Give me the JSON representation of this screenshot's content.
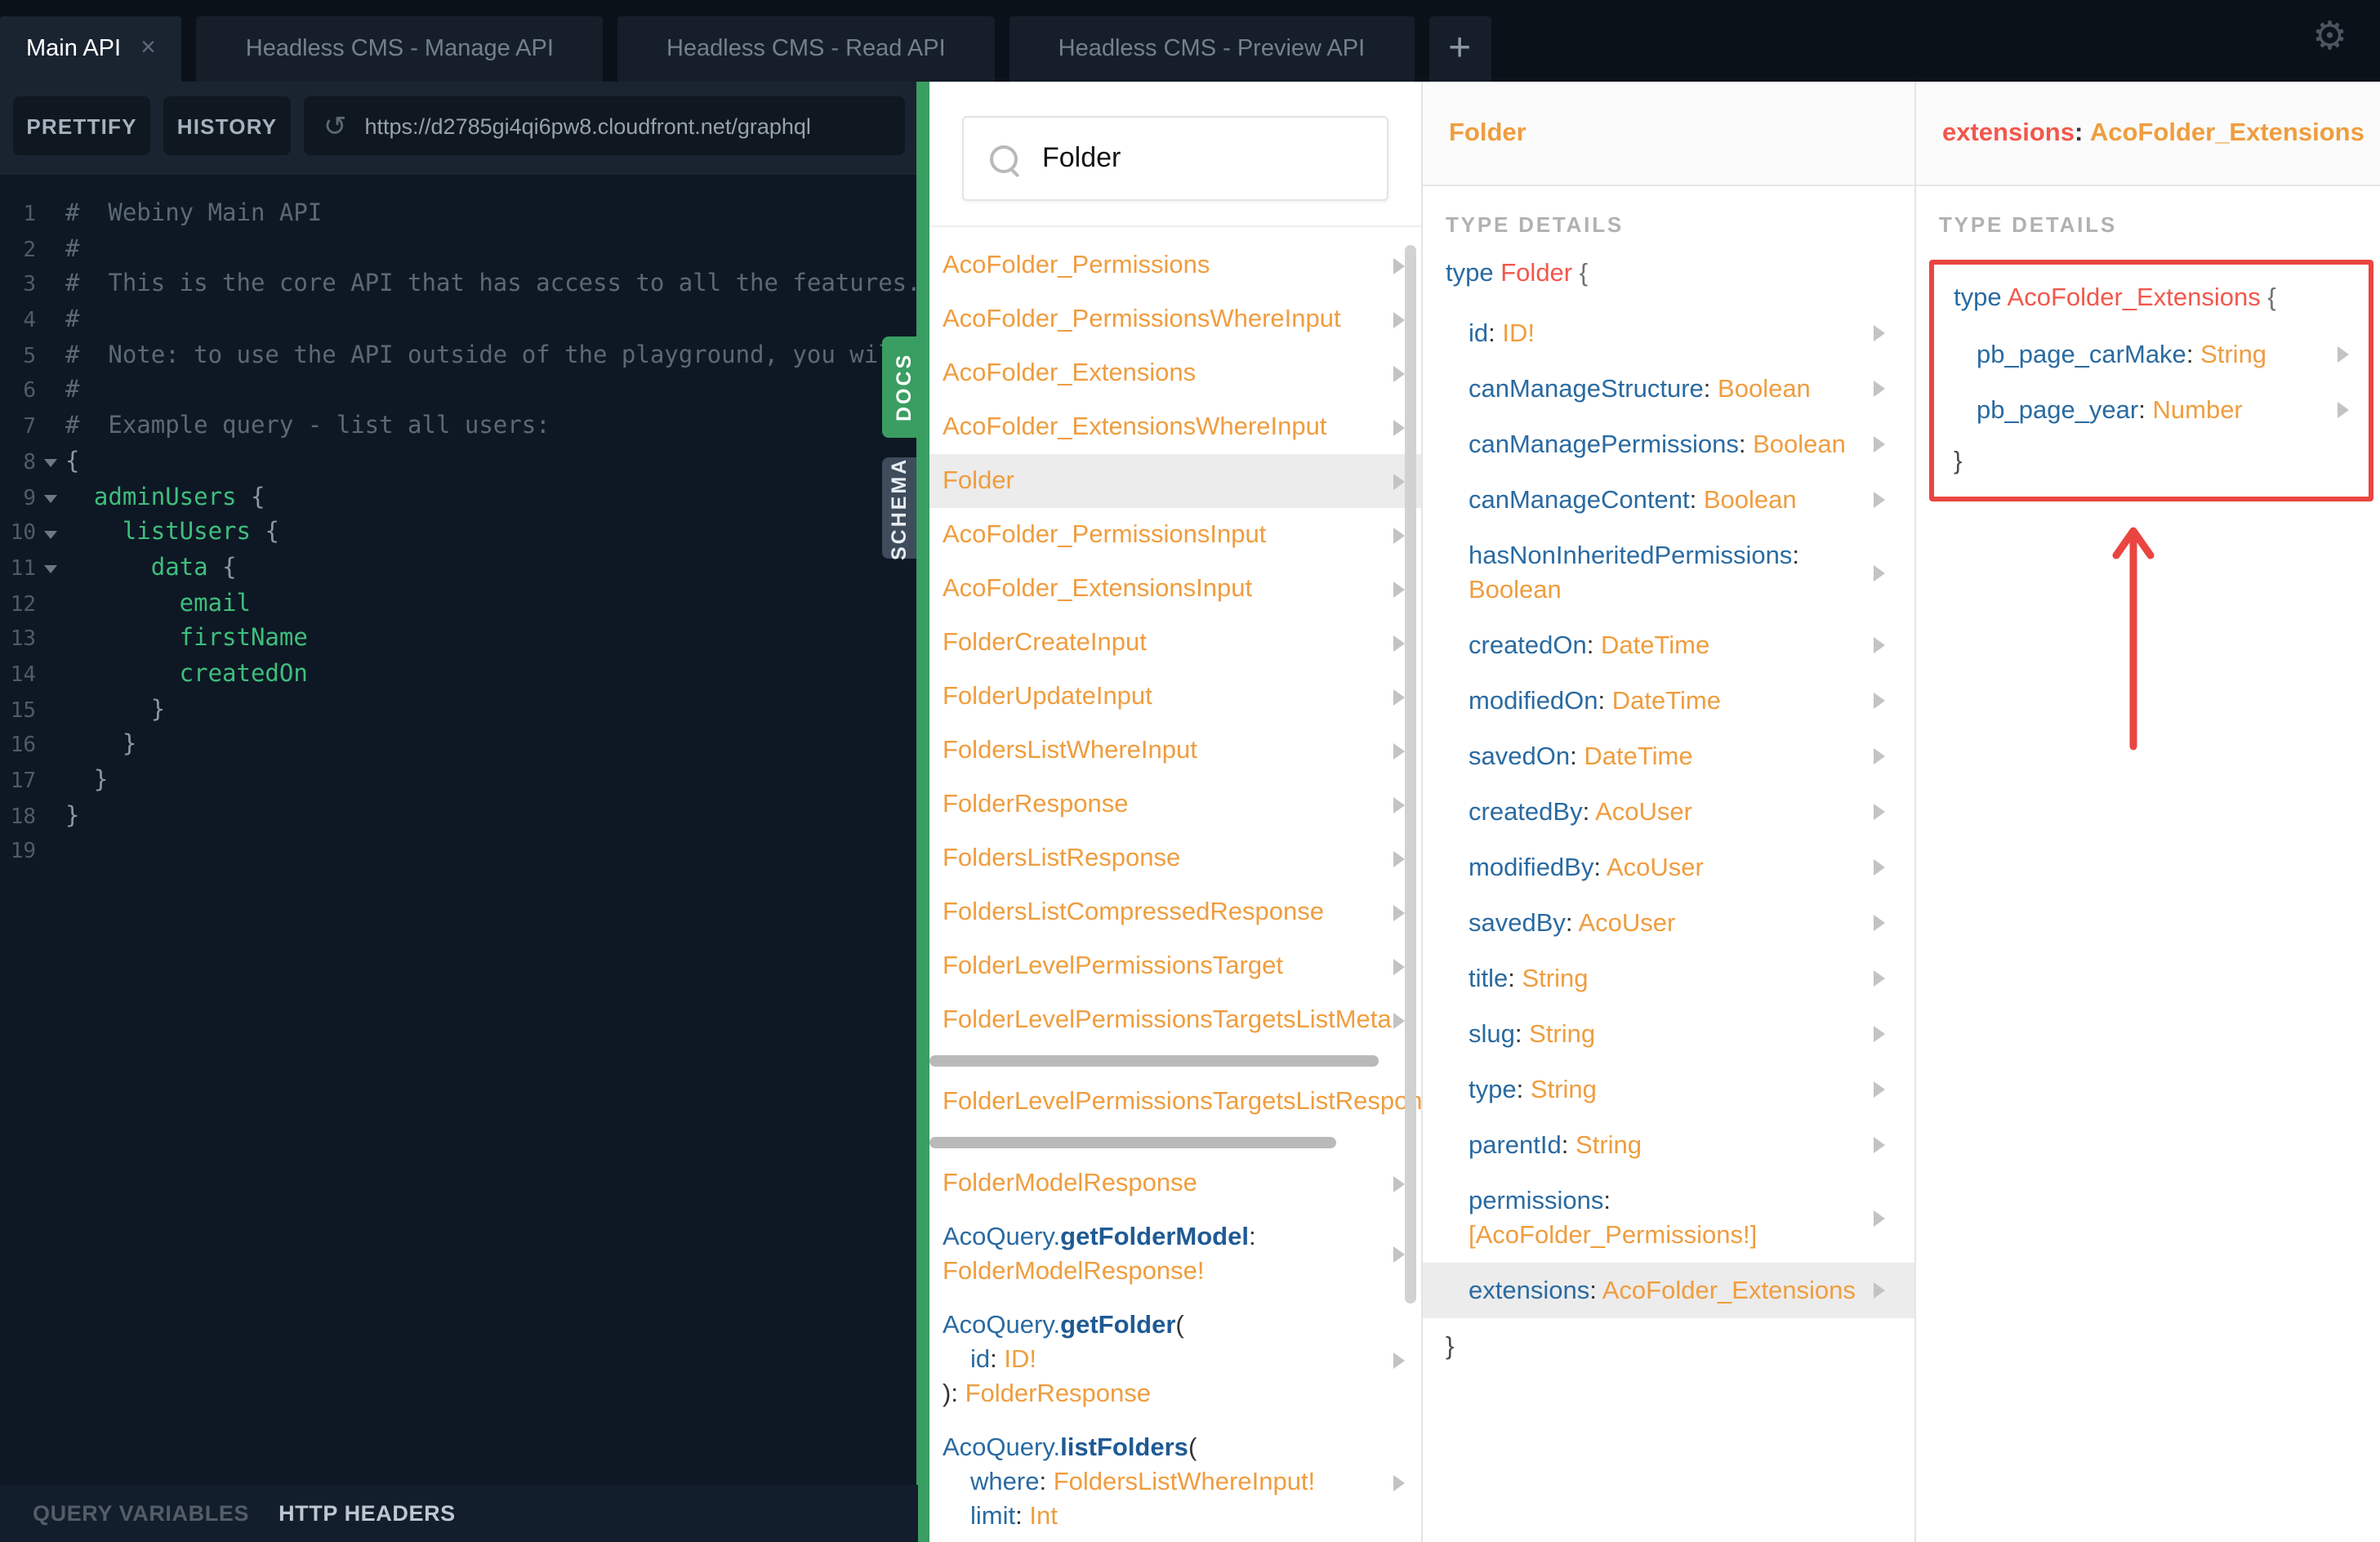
{
  "tabs": {
    "items": [
      {
        "label": "Main API",
        "active": true,
        "closable": true
      },
      {
        "label": "Headless CMS - Manage API",
        "active": false
      },
      {
        "label": "Headless CMS - Read API",
        "active": false
      },
      {
        "label": "Headless CMS - Preview API",
        "active": false
      }
    ],
    "add_button": "+"
  },
  "toolbar": {
    "prettify_label": "PRETTIFY",
    "history_label": "HISTORY",
    "url": "https://d2785gi4qi6pw8.cloudfront.net/graphql"
  },
  "editor": {
    "side_tabs": {
      "docs": "DOCS",
      "schema": "SCHEMA"
    },
    "lines": [
      {
        "n": "1",
        "fold": false,
        "parts": [
          {
            "c": "comment",
            "t": "#  Webiny Main API"
          }
        ]
      },
      {
        "n": "2",
        "fold": false,
        "parts": [
          {
            "c": "comment",
            "t": "#"
          }
        ]
      },
      {
        "n": "3",
        "fold": false,
        "parts": [
          {
            "c": "comment",
            "t": "#  This is the core API that has access to all the features."
          }
        ]
      },
      {
        "n": "4",
        "fold": false,
        "parts": [
          {
            "c": "comment",
            "t": "#"
          }
        ]
      },
      {
        "n": "5",
        "fold": false,
        "parts": [
          {
            "c": "comment",
            "t": "#  Note: to use the API outside of the playground, you will"
          }
        ]
      },
      {
        "n": "6",
        "fold": false,
        "parts": [
          {
            "c": "comment",
            "t": "#"
          }
        ]
      },
      {
        "n": "7",
        "fold": false,
        "parts": [
          {
            "c": "comment",
            "t": "#  Example query - list all users:"
          }
        ]
      },
      {
        "n": "8",
        "fold": true,
        "parts": [
          {
            "c": "punct",
            "t": "{"
          }
        ]
      },
      {
        "n": "9",
        "fold": true,
        "parts": [
          {
            "c": "field",
            "t": "  adminUsers"
          },
          {
            "c": "punct",
            "t": " {"
          }
        ]
      },
      {
        "n": "10",
        "fold": true,
        "parts": [
          {
            "c": "field",
            "t": "    listUsers"
          },
          {
            "c": "punct",
            "t": " {"
          }
        ]
      },
      {
        "n": "11",
        "fold": true,
        "parts": [
          {
            "c": "field",
            "t": "      data"
          },
          {
            "c": "punct",
            "t": " {"
          }
        ]
      },
      {
        "n": "12",
        "fold": false,
        "parts": [
          {
            "c": "field",
            "t": "        email"
          }
        ]
      },
      {
        "n": "13",
        "fold": false,
        "parts": [
          {
            "c": "field",
            "t": "        firstName"
          }
        ]
      },
      {
        "n": "14",
        "fold": false,
        "parts": [
          {
            "c": "field",
            "t": "        createdOn"
          }
        ]
      },
      {
        "n": "15",
        "fold": false,
        "parts": [
          {
            "c": "punct",
            "t": "      }"
          }
        ]
      },
      {
        "n": "16",
        "fold": false,
        "parts": [
          {
            "c": "punct",
            "t": "    }"
          }
        ]
      },
      {
        "n": "17",
        "fold": false,
        "parts": [
          {
            "c": "punct",
            "t": "  }"
          }
        ]
      },
      {
        "n": "18",
        "fold": false,
        "parts": [
          {
            "c": "punct",
            "t": "}"
          }
        ]
      },
      {
        "n": "19",
        "fold": false,
        "parts": []
      }
    ]
  },
  "footer": {
    "query_variables_label": "QUERY VARIABLES",
    "http_headers_label": "HTTP HEADERS"
  },
  "docs": {
    "search_value": "Folder",
    "list": [
      {
        "rows": [
          {
            "ind": 0,
            "s": [
              {
                "c": "orange",
                "t": "AcoFolder_Permissions"
              }
            ]
          }
        ],
        "chevron": true
      },
      {
        "rows": [
          {
            "ind": 0,
            "s": [
              {
                "c": "orange",
                "t": "AcoFolder_PermissionsWhereInput"
              }
            ]
          }
        ],
        "chevron": true
      },
      {
        "rows": [
          {
            "ind": 0,
            "s": [
              {
                "c": "orange",
                "t": "AcoFolder_Extensions"
              }
            ]
          }
        ],
        "chevron": true
      },
      {
        "rows": [
          {
            "ind": 0,
            "s": [
              {
                "c": "orange",
                "t": "AcoFolder_ExtensionsWhereInput"
              }
            ]
          }
        ],
        "chevron": true
      },
      {
        "rows": [
          {
            "ind": 0,
            "s": [
              {
                "c": "orange",
                "t": "Folder"
              }
            ]
          }
        ],
        "chevron": true,
        "highlight": true
      },
      {
        "rows": [
          {
            "ind": 0,
            "s": [
              {
                "c": "orange",
                "t": "AcoFolder_PermissionsInput"
              }
            ]
          }
        ],
        "chevron": true
      },
      {
        "rows": [
          {
            "ind": 0,
            "s": [
              {
                "c": "orange",
                "t": "AcoFolder_ExtensionsInput"
              }
            ]
          }
        ],
        "chevron": true
      },
      {
        "rows": [
          {
            "ind": 0,
            "s": [
              {
                "c": "orange",
                "t": "FolderCreateInput"
              }
            ]
          }
        ],
        "chevron": true
      },
      {
        "rows": [
          {
            "ind": 0,
            "s": [
              {
                "c": "orange",
                "t": "FolderUpdateInput"
              }
            ]
          }
        ],
        "chevron": true
      },
      {
        "rows": [
          {
            "ind": 0,
            "s": [
              {
                "c": "orange",
                "t": "FoldersListWhereInput"
              }
            ]
          }
        ],
        "chevron": true
      },
      {
        "rows": [
          {
            "ind": 0,
            "s": [
              {
                "c": "orange",
                "t": "FolderResponse"
              }
            ]
          }
        ],
        "chevron": true
      },
      {
        "rows": [
          {
            "ind": 0,
            "s": [
              {
                "c": "orange",
                "t": "FoldersListResponse"
              }
            ]
          }
        ],
        "chevron": true
      },
      {
        "rows": [
          {
            "ind": 0,
            "s": [
              {
                "c": "orange",
                "t": "FoldersListCompressedResponse"
              }
            ]
          }
        ],
        "chevron": true
      },
      {
        "rows": [
          {
            "ind": 0,
            "s": [
              {
                "c": "orange",
                "t": "FolderLevelPermissionsTarget"
              }
            ]
          }
        ],
        "chevron": true
      },
      {
        "rows": [
          {
            "ind": 0,
            "s": [
              {
                "c": "orange",
                "t": "FolderLevelPermissionsTargetsListMeta"
              }
            ]
          }
        ],
        "chevron": true,
        "hbar": 275
      },
      {
        "rows": [
          {
            "ind": 0,
            "s": [
              {
                "c": "orange",
                "t": "FolderLevelPermissionsTargetsListResponse"
              }
            ]
          }
        ],
        "chevron": false,
        "hbar": 249
      },
      {
        "rows": [
          {
            "ind": 0,
            "s": [
              {
                "c": "orange",
                "t": "FolderModelResponse"
              }
            ]
          }
        ],
        "chevron": true
      },
      {
        "rows": [
          {
            "ind": 0,
            "s": [
              {
                "c": "blue",
                "t": "AcoQuery."
              },
              {
                "c": "blueBold",
                "t": "getFolderModel"
              },
              {
                "c": "dark",
                "t": ":"
              }
            ]
          },
          {
            "ind": 0,
            "s": [
              {
                "c": "orange",
                "t": "FolderModelResponse!"
              }
            ]
          }
        ],
        "chevron": true
      },
      {
        "rows": [
          {
            "ind": 0,
            "s": [
              {
                "c": "blue",
                "t": "AcoQuery."
              },
              {
                "c": "blueBold",
                "t": "getFolder"
              },
              {
                "c": "dark",
                "t": "("
              }
            ]
          },
          {
            "ind": 1,
            "s": [
              {
                "c": "blue",
                "t": "id"
              },
              {
                "c": "dark",
                "t": ": "
              },
              {
                "c": "orange",
                "t": "ID!"
              }
            ]
          },
          {
            "ind": 0,
            "s": [
              {
                "c": "dark",
                "t": "): "
              },
              {
                "c": "orange",
                "t": "FolderResponse"
              }
            ]
          }
        ],
        "chevron": true
      },
      {
        "rows": [
          {
            "ind": 0,
            "s": [
              {
                "c": "blue",
                "t": "AcoQuery."
              },
              {
                "c": "blueBold",
                "t": "listFolders"
              },
              {
                "c": "dark",
                "t": "("
              }
            ]
          },
          {
            "ind": 1,
            "s": [
              {
                "c": "blue",
                "t": "where"
              },
              {
                "c": "dark",
                "t": ": "
              },
              {
                "c": "orange",
                "t": "FoldersListWhereInput!"
              }
            ]
          },
          {
            "ind": 1,
            "s": [
              {
                "c": "blue",
                "t": "limit"
              },
              {
                "c": "dark",
                "t": ": "
              },
              {
                "c": "orange",
                "t": "Int"
              }
            ]
          }
        ],
        "chevron": true
      }
    ]
  },
  "folder_panel": {
    "header": "Folder",
    "section_label": "TYPE DETAILS",
    "type_keyword": "type",
    "type_name": "Folder",
    "open_brace": "{",
    "close_brace": "}",
    "fields": [
      {
        "name": "id",
        "type": "ID!"
      },
      {
        "name": "canManageStructure",
        "type": "Boolean"
      },
      {
        "name": "canManagePermissions",
        "type": "Boolean"
      },
      {
        "name": "canManageContent",
        "type": "Boolean"
      },
      {
        "name": "hasNonInheritedPermissions",
        "type": "Boolean"
      },
      {
        "name": "createdOn",
        "type": "DateTime"
      },
      {
        "name": "modifiedOn",
        "type": "DateTime"
      },
      {
        "name": "savedOn",
        "type": "DateTime"
      },
      {
        "name": "createdBy",
        "type": "AcoUser"
      },
      {
        "name": "modifiedBy",
        "type": "AcoUser"
      },
      {
        "name": "savedBy",
        "type": "AcoUser"
      },
      {
        "name": "title",
        "type": "String"
      },
      {
        "name": "slug",
        "type": "String"
      },
      {
        "name": "type",
        "type": "String"
      },
      {
        "name": "parentId",
        "type": "String"
      },
      {
        "name": "permissions",
        "type": "[AcoFolder_Permissions!]"
      },
      {
        "name": "extensions",
        "type": "AcoFolder_Extensions",
        "highlight": true
      }
    ]
  },
  "extensions_panel": {
    "header_field": "extensions",
    "header_sep": ": ",
    "header_type": "AcoFolder_Extensions",
    "section_label": "TYPE DETAILS",
    "type_keyword": "type",
    "type_name": "AcoFolder_Extensions",
    "open_brace": "{",
    "close_brace": "}",
    "fields": [
      {
        "name": "pb_page_carMake",
        "type": "String"
      },
      {
        "name": "pb_page_year",
        "type": "Number"
      }
    ]
  },
  "colors": {
    "accent_green": "#3a9e62",
    "type_orange": "#ef9d3f",
    "field_blue": "#2a6aa1",
    "type_red": "#f2574c",
    "annotation_red": "#ea4540",
    "highlight_gray": "#ececec",
    "editor_bg": "#0e1824",
    "topbar_bg": "#0b1119"
  }
}
